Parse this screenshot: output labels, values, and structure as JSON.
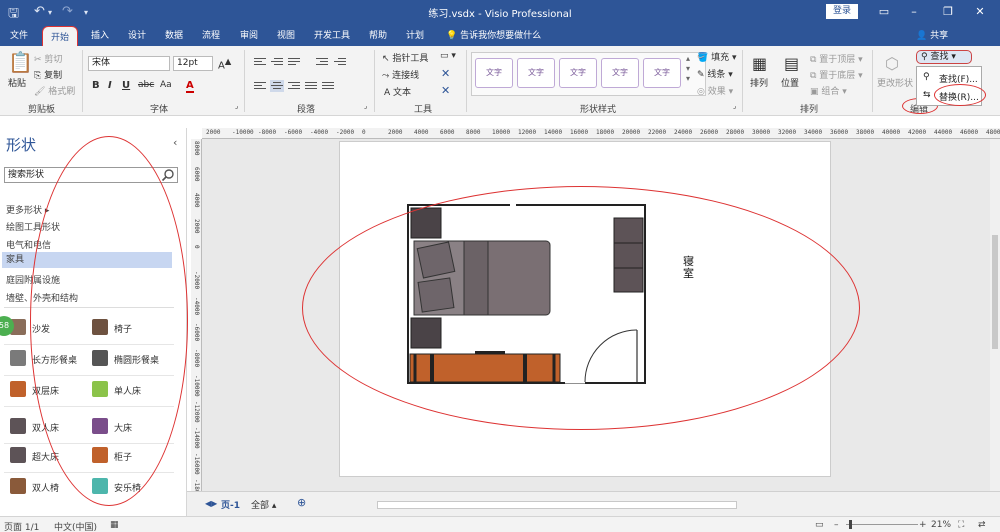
{
  "window": {
    "title": "练习.vsdx  -  Visio Professional",
    "login": "登录"
  },
  "tabs": [
    "文件",
    "开始",
    "插入",
    "设计",
    "数据",
    "流程",
    "审阅",
    "视图",
    "开发工具",
    "帮助",
    "计划"
  ],
  "tell_me": "告诉我你想要做什么",
  "share": "共享",
  "ribbon": {
    "clipboard": {
      "paste": "粘贴",
      "cut": "剪切",
      "copy": "复制",
      "format_painter": "格式刷",
      "label": "剪贴板"
    },
    "font": {
      "name": "宋体",
      "size": "12pt",
      "label": "字体",
      "buttons": [
        "B",
        "I",
        "U",
        "abc",
        "Aa",
        "A"
      ]
    },
    "paragraph": {
      "label": "段落"
    },
    "tools": {
      "pointer": "指针工具",
      "connector": "连接线",
      "text": "文本",
      "label": "工具"
    },
    "shape_styles": {
      "samples": [
        "文字",
        "文字",
        "文字",
        "文字",
        "文字"
      ],
      "fill": "填充",
      "line": "线条",
      "effects": "效果",
      "label": "形状样式"
    },
    "arrange": {
      "arrange": "排列",
      "position": "位置",
      "bring_front": "置于顶层",
      "send_back": "置于底层",
      "group": "组合",
      "label": "排列"
    },
    "change_shape": "更改形状",
    "editing": {
      "find": "查找",
      "label": "编辑",
      "menu": [
        "查找(F)...",
        "替换(R)..."
      ]
    }
  },
  "shapes_pane": {
    "title": "形状",
    "search_placeholder": "搜索形状",
    "more_shapes": "更多形状",
    "stencils": [
      "绘图工具形状",
      "电气和电信",
      "家具",
      "庭园附属设施",
      "墙壁、外壳和结构"
    ],
    "selected_stencil": "家具",
    "items": [
      {
        "label": "沙发",
        "color": "#8a6d5a"
      },
      {
        "label": "椅子",
        "color": "#6e5240"
      },
      {
        "label": "长方形餐桌",
        "color": "#7a7a7a"
      },
      {
        "label": "椭圆形餐桌",
        "color": "#555555"
      },
      {
        "label": "双层床",
        "color": "#c0612b"
      },
      {
        "label": "单人床",
        "color": "#8bc34a"
      },
      {
        "label": "双人床",
        "color": "#5d5357"
      },
      {
        "label": "大床",
        "color": "#7a4d8a"
      },
      {
        "label": "超大床",
        "color": "#5d5357"
      },
      {
        "label": "柜子",
        "color": "#c0612b"
      },
      {
        "label": "双人椅",
        "color": "#8a5a3a"
      },
      {
        "label": "安乐椅",
        "color": "#4db6ac"
      }
    ],
    "badge": "58"
  },
  "canvas": {
    "room_label": "寝室"
  },
  "ruler_h": [
    "2000",
    "-10000",
    "-8000",
    "-6000",
    "-4000",
    "-2000",
    "0",
    "2000",
    "4000",
    "6000",
    "8000",
    "10000",
    "12000",
    "14000",
    "16000",
    "18000",
    "20000",
    "22000",
    "24000",
    "26000",
    "28000",
    "30000",
    "32000",
    "34000",
    "36000",
    "38000",
    "40000",
    "42000",
    "44000",
    "46000",
    "48000"
  ],
  "ruler_v": [
    "8000",
    "6000",
    "4000",
    "2000",
    "0",
    "-2000",
    "-4000",
    "-6000",
    "-8000",
    "-10000",
    "-12000",
    "-14000",
    "-16000",
    "-18000"
  ],
  "page_tabs": {
    "page": "页-1",
    "all": "全部"
  },
  "status": {
    "page": "页面 1/1",
    "lang": "中文(中国)",
    "zoom": "21%"
  }
}
